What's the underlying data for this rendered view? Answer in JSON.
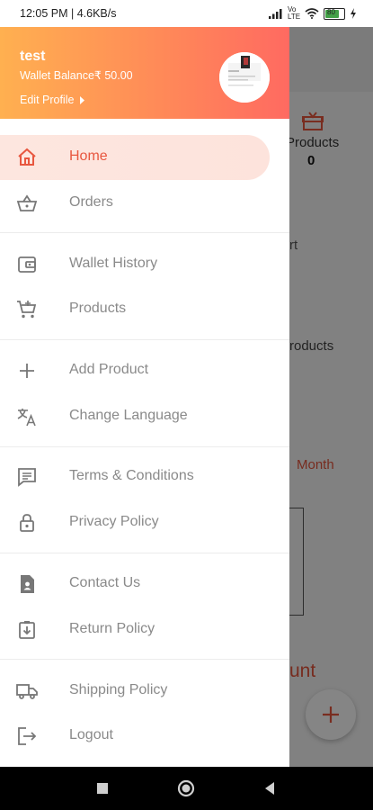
{
  "status_bar": {
    "time_speed": "12:05 PM | 4.6KB/s",
    "network": "Vo LTE",
    "battery_level": "80"
  },
  "drawer": {
    "header": {
      "username": "test",
      "wallet_balance": "Wallet Balance₹ 50.00",
      "edit_profile": "Edit Profile"
    },
    "items": [
      {
        "label": "Home",
        "icon": "home-icon",
        "active": true
      },
      {
        "label": "Orders",
        "icon": "basket-icon"
      },
      {
        "label": "Wallet History",
        "icon": "wallet-icon"
      },
      {
        "label": "Products",
        "icon": "cart-icon"
      },
      {
        "label": "Add Product",
        "icon": "plus-icon"
      },
      {
        "label": "Change Language",
        "icon": "translate-icon"
      },
      {
        "label": "Terms & Conditions",
        "icon": "document-icon"
      },
      {
        "label": "Privacy Policy",
        "icon": "lock-icon"
      },
      {
        "label": "Contact Us",
        "icon": "contact-icon"
      },
      {
        "label": "Return Policy",
        "icon": "return-icon"
      },
      {
        "label": "Shipping Policy",
        "icon": "truck-icon"
      },
      {
        "label": "Logout",
        "icon": "logout-icon"
      }
    ]
  },
  "background_app": {
    "products_label": "Products",
    "products_count": "0",
    "partial_t": "rt",
    "partial_products": "roducts",
    "month_label": "Month",
    "partial_unt": "unt"
  },
  "colors": {
    "accent": "#e8573f",
    "header_gradient_start": "#ffb050",
    "header_gradient_end": "#ff6a61"
  }
}
